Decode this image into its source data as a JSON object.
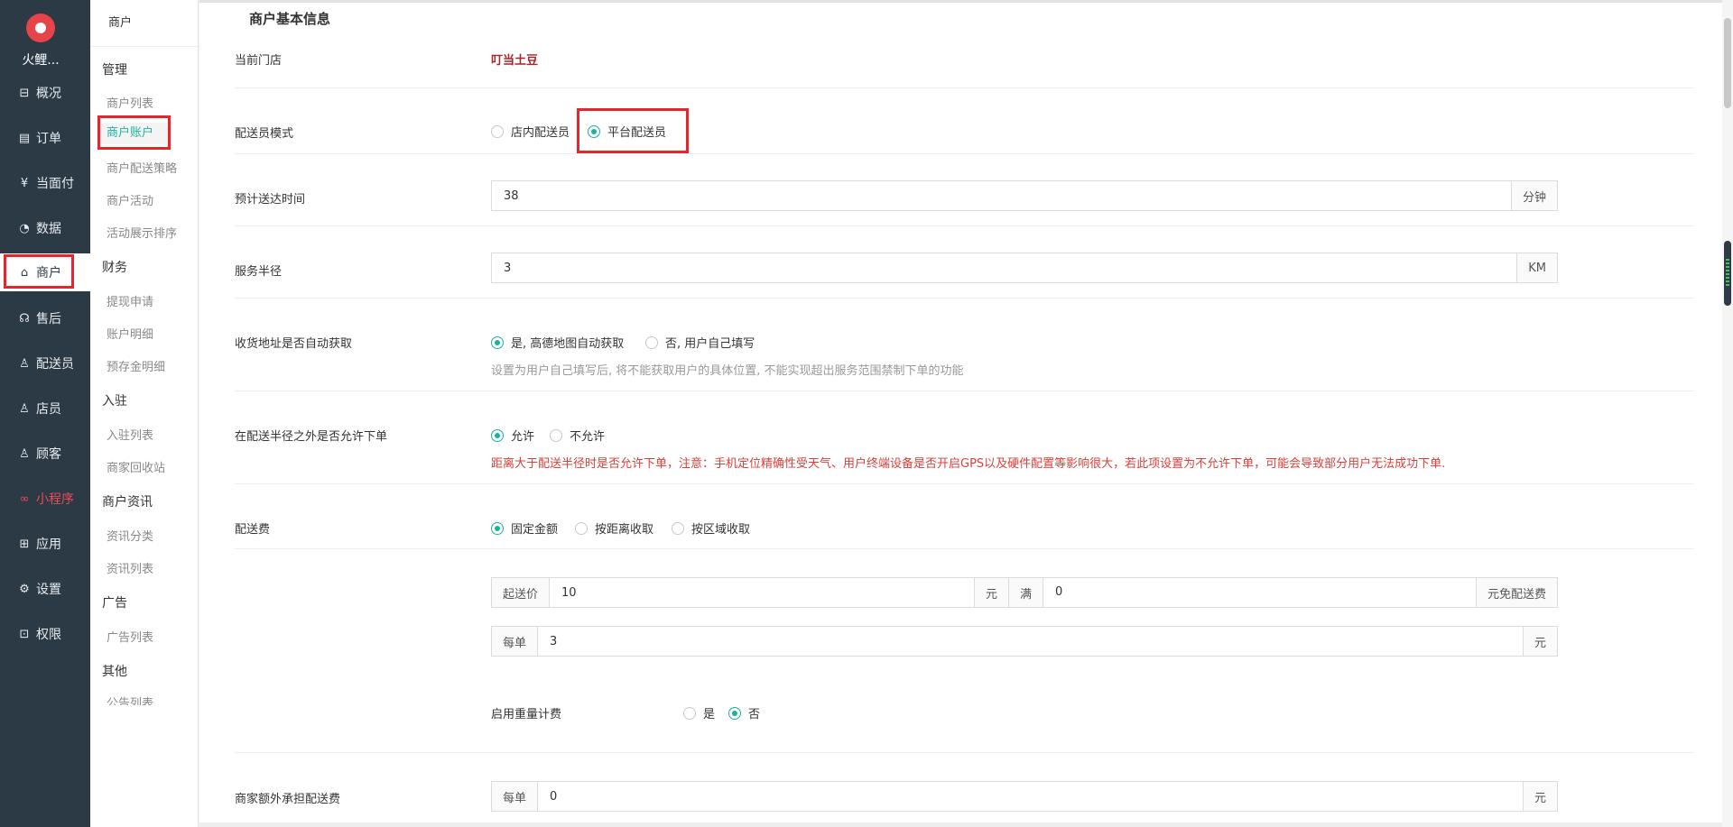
{
  "app": {
    "brand": "火鲤..."
  },
  "sidebar": {
    "items": [
      {
        "label": "概况",
        "icon": "dashboard-icon",
        "glyph": "⊟"
      },
      {
        "label": "订单",
        "icon": "order-icon",
        "glyph": "▤"
      },
      {
        "label": "当面付",
        "icon": "pay-icon",
        "glyph": "¥"
      },
      {
        "label": "数据",
        "icon": "chart-icon",
        "glyph": "◔"
      },
      {
        "label": "商户",
        "icon": "store-icon",
        "glyph": "⌂"
      },
      {
        "label": "售后",
        "icon": "headset-icon",
        "glyph": "☊"
      },
      {
        "label": "配送员",
        "icon": "courier-icon",
        "glyph": "♙"
      },
      {
        "label": "店员",
        "icon": "staff-icon",
        "glyph": "♙"
      },
      {
        "label": "顾客",
        "icon": "customer-icon",
        "glyph": "♙"
      },
      {
        "label": "小程序",
        "icon": "miniprogram-icon",
        "glyph": "∞"
      },
      {
        "label": "应用",
        "icon": "apps-icon",
        "glyph": "⊞"
      },
      {
        "label": "设置",
        "icon": "gear-icon",
        "glyph": "⚙"
      },
      {
        "label": "权限",
        "icon": "lock-icon",
        "glyph": "⊡"
      }
    ]
  },
  "subnav": {
    "title": "商户",
    "groups": {
      "manage": "管理",
      "finance": "财务",
      "join": "入驻",
      "news": "商户资讯",
      "ads": "广告",
      "other": "其他"
    },
    "items": {
      "merchant_list": "商户列表",
      "merchant_account": "商户账户",
      "delivery_strategy": "商户配送策略",
      "activities": "商户活动",
      "activity_sort": "活动展示排序",
      "withdraw": "提现申请",
      "account_detail": "账户明细",
      "deposit_detail": "预存金明细",
      "join_list": "入驻列表",
      "recycle": "商家回收站",
      "news_category": "资讯分类",
      "news_list": "资讯列表",
      "ad_list": "广告列表",
      "notice_list": "公告列表"
    }
  },
  "form": {
    "section_title": "商户基本信息",
    "current_store": {
      "label": "当前门店",
      "value": "叮当土豆"
    },
    "courier_mode": {
      "label": "配送员模式",
      "options": [
        "店内配送员",
        "平台配送员"
      ],
      "selected": "平台配送员"
    },
    "eta": {
      "label": "预计送达时间",
      "value": "38",
      "unit": "分钟"
    },
    "radius": {
      "label": "服务半径",
      "value": "3",
      "unit": "KM"
    },
    "auto_address": {
      "label": "收货地址是否自动获取",
      "options": [
        "是, 高德地图自动获取",
        "否, 用户自己填写"
      ],
      "selected": "是, 高德地图自动获取",
      "hint": "设置为用户自己填写后, 将不能获取用户的具体位置, 不能实现超出服务范围禁制下单的功能"
    },
    "outside_radius": {
      "label": "在配送半径之外是否允许下单",
      "options": [
        "允许",
        "不允许"
      ],
      "selected": "允许",
      "warning": "距离大于配送半径时是否允许下单，注意：手机定位精确性受天气、用户终端设备是否开启GPS以及硬件配置等影响很大，若此项设置为不允许下单，可能会导致部分用户无法成功下单."
    },
    "delivery_fee": {
      "label": "配送费",
      "options": [
        "固定金额",
        "按距离收取",
        "按区域收取"
      ],
      "selected": "固定金额",
      "min_price_prefix": "起送价",
      "min_price": "10",
      "min_price_unit": "元",
      "free_prefix": "满",
      "free_value": "0",
      "free_suffix": "元免配送费",
      "per_order_prefix": "每单",
      "per_order": "3",
      "per_order_unit": "元"
    },
    "weight_billing": {
      "label": "启用重量计费",
      "options": [
        "是",
        "否"
      ],
      "selected": "否"
    },
    "merchant_extra": {
      "label": "商家额外承担配送费",
      "prefix": "每单",
      "value": "0",
      "unit": "元"
    }
  }
}
